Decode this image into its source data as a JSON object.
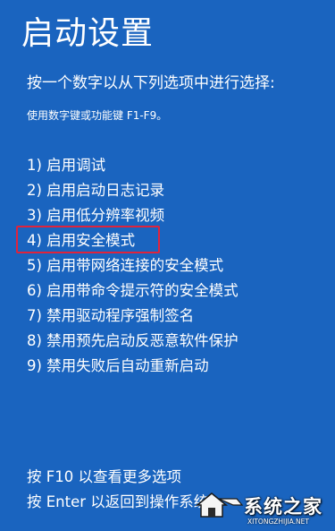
{
  "screen": {
    "title": "启动设置",
    "subtitle": "按一个数字以从下列选项中进行选择:",
    "hint": "使用数字键或功能键 F1-F9。"
  },
  "options": [
    {
      "label": "1) 启用调试"
    },
    {
      "label": "2) 启用启动日志记录"
    },
    {
      "label": "3) 启用低分辨率视频"
    },
    {
      "label": "4) 启用安全模式",
      "highlighted": true
    },
    {
      "label": "5) 启用带网络连接的安全模式"
    },
    {
      "label": "6) 启用带命令提示符的安全模式"
    },
    {
      "label": "7) 禁用驱动程序强制签名"
    },
    {
      "label": "8) 禁用预先启动反恶意软件保护"
    },
    {
      "label": "9) 禁用失败后自动重新启动"
    }
  ],
  "footer": {
    "more_options": "按 F10 以查看更多选项",
    "return": "按 Enter 以返回到操作系统"
  },
  "watermark": {
    "text": "系统之家",
    "url": "XITONGZHIJIA.NET",
    "logo_icon": "house-logo-icon"
  },
  "colors": {
    "background": "#1a64bf",
    "text": "#ffffff",
    "highlight_outline": "#e0233b"
  }
}
